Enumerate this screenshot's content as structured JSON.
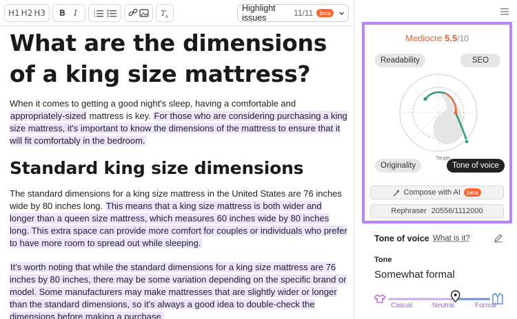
{
  "toolbar": {
    "heading_buttons": [
      "H1",
      "H2",
      "H3"
    ],
    "highlight": {
      "label": "Highlight issues",
      "count": "11/11",
      "badge": "beta"
    }
  },
  "article": {
    "title": "What are the dimensions of a king size mattress?",
    "p1": {
      "a": "When it comes to getting a good night's sleep, having a comfortable and ",
      "b": "appropriately-sized",
      "c": " mattress is key. ",
      "d": "For those who are considering purchasing a king size mattress, it's important to know the dimensions of the mattress to ensure that it will fit comfortably in the bedroom."
    },
    "h2": "Standard king size dimensions",
    "p2": {
      "a": "The standard dimensions for a king size mattress in the United States are 76 inches wide by 80 inches long. ",
      "b": "This means that a king size mattress is both wider and longer than a queen size mattress, which measures 60 inches wide by 80 inches long. This extra space can provide more comfort for couples or individuals who prefer to have more room to spread out while sleeping."
    },
    "p3": "It's worth noting that while the standard dimensions for a king size mattress are 76 inches by 80 inches, there may be some variation depending on the specific brand or model. Some manufacturers may make mattresses that are slightly wider or longer than the standard dimensions, so it's always a good idea to double-check the dimensions before making a purchase."
  },
  "score": {
    "label": "Mediocre",
    "value": "5.5",
    "max": "/10",
    "color": "#e65d2e"
  },
  "tabs": {
    "readability": "Readability",
    "seo": "SEO",
    "originality": "Originality",
    "tone": "Tone of voice",
    "target": "Target"
  },
  "actions": {
    "compose": "Compose with AI",
    "compose_badge": "beta",
    "rephraser": "Rephraser",
    "rephraser_count": "20556/1112000"
  },
  "tone_of_voice": {
    "heading": "Tone of voice",
    "link": "What is it?",
    "tone_label": "Tone",
    "tone_value": "Somewhat formal",
    "scale_labels": [
      "Casual",
      "Neutral",
      "Formal"
    ],
    "marker_level": 0.66
  },
  "colors": {
    "accent": "#b685f6",
    "highlight": "#ede5ff",
    "green": "#2f9a6b",
    "orange": "#e8683d"
  },
  "icons": [
    "bold-icon",
    "italic-icon",
    "ordered-list-icon",
    "bullet-list-icon",
    "link-icon",
    "image-icon",
    "clear-format-icon",
    "chevron-down-icon",
    "menu-icon",
    "sparkle-icon",
    "pencil-icon",
    "shirt-icon",
    "blazer-icon",
    "location-pin-icon"
  ]
}
